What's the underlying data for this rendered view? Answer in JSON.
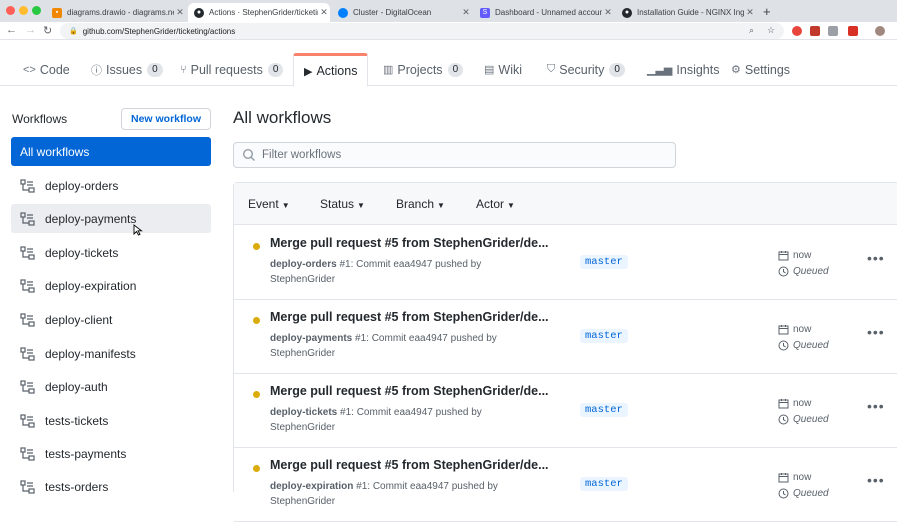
{
  "browser": {
    "tabs": [
      {
        "title": "diagrams.drawio - diagrams.net",
        "icon": "drawio-icon",
        "active": false
      },
      {
        "title": "Actions · StephenGrider/ticketing",
        "icon": "github-icon",
        "active": true
      },
      {
        "title": "Cluster - DigitalOcean",
        "icon": "digitalocean-icon",
        "active": false
      },
      {
        "title": "Dashboard - Unnamed account",
        "icon": "stripe-icon",
        "active": false
      },
      {
        "title": "Installation Guide - NGINX Ingress",
        "icon": "github-icon",
        "active": false
      }
    ],
    "url": "github.com/StephenGrider/ticketing/actions"
  },
  "repo_nav": {
    "tabs": [
      {
        "label": "Code",
        "icon": "code-icon"
      },
      {
        "label": "Issues",
        "icon": "issue-icon",
        "count": "0"
      },
      {
        "label": "Pull requests",
        "icon": "pull-request-icon",
        "count": "0"
      },
      {
        "label": "Actions",
        "icon": "play-icon",
        "active": true
      },
      {
        "label": "Projects",
        "icon": "project-icon",
        "count": "0"
      },
      {
        "label": "Wiki",
        "icon": "book-icon"
      },
      {
        "label": "Security",
        "icon": "shield-icon",
        "count": "0"
      },
      {
        "label": "Insights",
        "icon": "graph-icon"
      },
      {
        "label": "Settings",
        "icon": "gear-icon"
      }
    ]
  },
  "sidebar": {
    "heading": "Workflows",
    "new_workflow_label": "New workflow",
    "all_workflows_label": "All workflows",
    "items": [
      "deploy-orders",
      "deploy-payments",
      "deploy-tickets",
      "deploy-expiration",
      "deploy-client",
      "deploy-manifests",
      "deploy-auth",
      "tests-tickets",
      "tests-payments",
      "tests-orders"
    ]
  },
  "main": {
    "title": "All workflows",
    "filter_placeholder": "Filter workflows",
    "filters": [
      "Event",
      "Status",
      "Branch",
      "Actor"
    ],
    "runs": [
      {
        "title": "Merge pull request #5 from StephenGrider/de...",
        "workflow": "deploy-orders",
        "meta": " #1: Commit eaa4947 pushed by StephenGrider",
        "branch": "master",
        "when": "now",
        "status": "Queued"
      },
      {
        "title": "Merge pull request #5 from StephenGrider/de...",
        "workflow": "deploy-payments",
        "meta": " #1: Commit eaa4947 pushed by StephenGrider",
        "branch": "master",
        "when": "now",
        "status": "Queued"
      },
      {
        "title": "Merge pull request #5 from StephenGrider/de...",
        "workflow": "deploy-tickets",
        "meta": " #1: Commit eaa4947 pushed by StephenGrider",
        "branch": "master",
        "when": "now",
        "status": "Queued"
      },
      {
        "title": "Merge pull request #5 from StephenGrider/de...",
        "workflow": "deploy-expiration",
        "meta": " #1: Commit eaa4947 pushed by StephenGrider",
        "branch": "master",
        "when": "now",
        "status": "Queued"
      }
    ]
  },
  "colors": {
    "accent": "#0366d6",
    "active_tab_border": "#f9826c",
    "queued_dot": "#dbab09"
  }
}
